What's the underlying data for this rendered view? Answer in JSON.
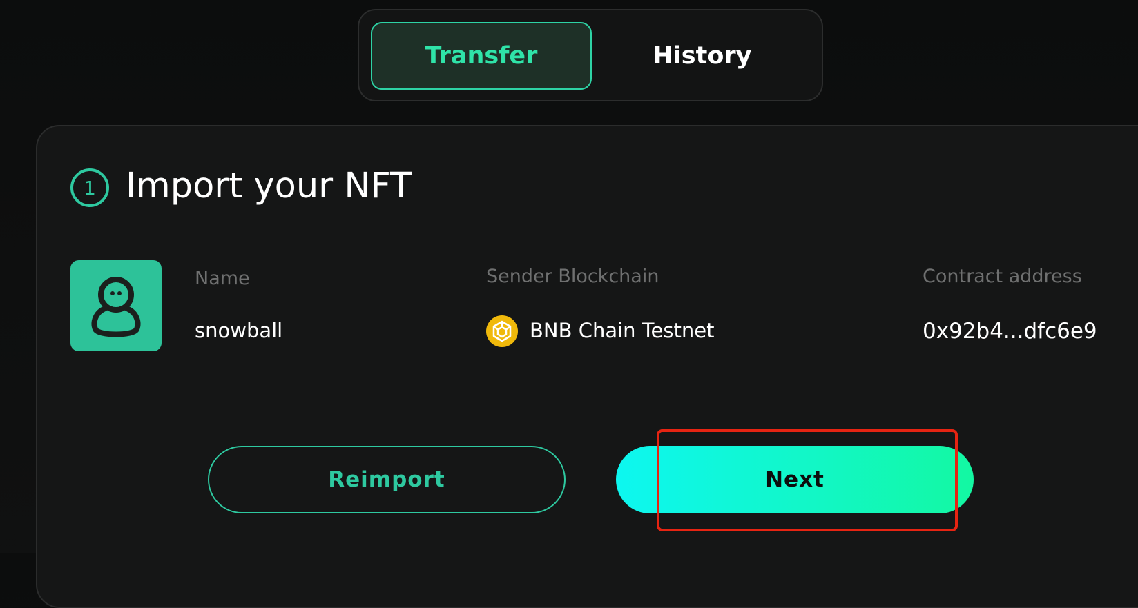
{
  "tabs": [
    {
      "label": "Transfer",
      "active": true
    },
    {
      "label": "History",
      "active": false
    }
  ],
  "step": {
    "number": "1",
    "title": "Import your NFT"
  },
  "nft": {
    "thumbnail_icon": "snowman-icon",
    "name_label": "Name",
    "name_value": "snowball",
    "chain_label": "Sender Blockchain",
    "chain_icon": "bnb-chain-icon",
    "chain_value": "BNB Chain Testnet",
    "contract_label": "Contract address",
    "contract_value": "0x92b4...dfc6e9"
  },
  "actions": {
    "reimport_label": "Reimport",
    "next_label": "Next"
  },
  "colors": {
    "accent": "#2ec9a0",
    "active_tab_text": "#2fe3a8",
    "bnb": "#f0b90b",
    "highlight": "#e62412"
  }
}
